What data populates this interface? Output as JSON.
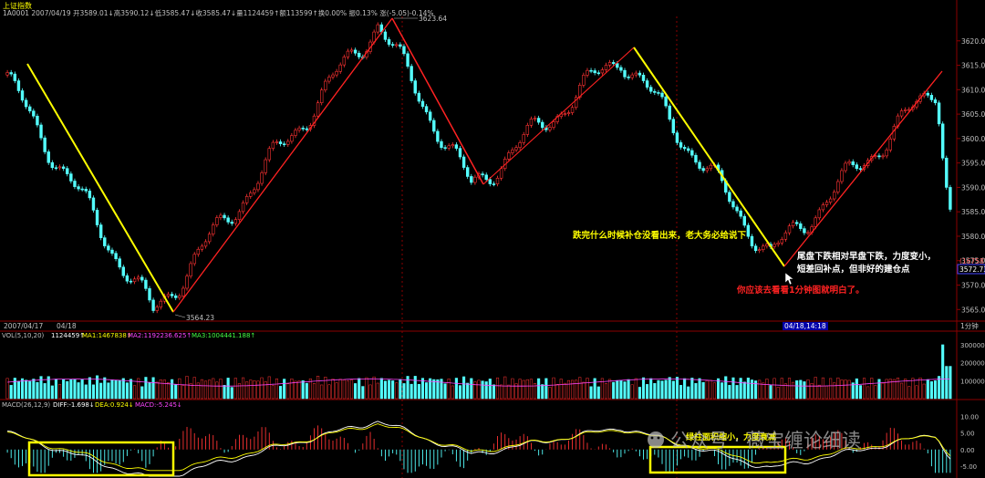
{
  "header": {
    "title": "上证指数",
    "info_line": "1A0001 2007/04/19 开3589.01↓高3590.12↓低3585.47↓收3585.47↓量1124459↑额113599↑换0.00% 振0.13% 涨(-5.05)-0.14%"
  },
  "annotations": {
    "high_label": "3623.64",
    "low_label": "3564.23",
    "note_yellow": "跌完什么时候补仓没看出来，老大务必给说下",
    "note_white_1": "尾盘下跌相对早盘下跌，力度变小，",
    "note_white_2": "短差回补点，但非好的建仓点",
    "note_red": "你应该去看看1分钟图就明白了。",
    "macd_note": "绿柱面积缩小，力度衰减"
  },
  "price_axis": {
    "ticks": [
      "3620.00",
      "3615.00",
      "3610.00",
      "3605.00",
      "3600.00",
      "3595.00",
      "3590.00",
      "3585.00",
      "3580.00",
      "3575.00",
      "3570.00",
      "3565.00"
    ],
    "current_badge": "(16758)",
    "current_price": "3572.73"
  },
  "time_axis": {
    "left_date": "2007/04/17",
    "left_time": "04/18",
    "cursor_label": "04/18,14:18",
    "period": "1分钟"
  },
  "volume_panel": {
    "title": "VOL(5,10,20)",
    "vol": "1124459↑",
    "ma1": "MA1:1467838↑",
    "ma2": "MA2:1192236.625↑",
    "ma3": "MA3:1004441.188↑",
    "ticks": [
      "300000",
      "200000",
      "100000"
    ]
  },
  "macd_panel": {
    "title": "MACD(26,12,9)",
    "diff": "DIFF:-1.698↓",
    "dea": "DEA:0.924↓",
    "macd": "MACD:-5.245↓",
    "ticks": [
      "10.00",
      "5.00",
      "0.00",
      "-5.00"
    ]
  },
  "watermark": {
    "text": "公众号 · 薇宝缠论细读"
  },
  "colors": {
    "up": "#ff3333",
    "down": "#54ffff",
    "trend_down": "#ffff00",
    "trend_up": "#ff2222",
    "ma1": "#ffffff",
    "ma2": "#ffff00",
    "ma3": "#ff44ff",
    "grid": "#8b0000",
    "note_yellow": "#ffff00",
    "note_white": "#ffffff",
    "note_red": "#ff2222"
  },
  "chart_data": [
    {
      "type": "candlestick",
      "title": "上证指数",
      "ylim": [
        3563,
        3625
      ],
      "x_range": [
        "2007/04/17",
        "2007/04/19"
      ],
      "swing_points": [
        {
          "label": "start",
          "price": 3613
        },
        {
          "label": "low",
          "price": 3564.23
        },
        {
          "label": "high",
          "price": 3623.64
        },
        {
          "label": "pullback",
          "price": 3590
        },
        {
          "label": "rebound",
          "price": 3617
        },
        {
          "label": "low2",
          "price": 3576
        },
        {
          "label": "end-high",
          "price": 3611
        }
      ],
      "last_close": 3585.47
    },
    {
      "type": "bar",
      "title": "VOL(5,10,20)",
      "ylim": [
        0,
        330000
      ],
      "last_value": 1124459,
      "peak_value": 300000
    },
    {
      "type": "bar",
      "title": "MACD(26,12,9)",
      "ylim": [
        -8,
        12
      ],
      "series": [
        {
          "name": "DIFF",
          "last": -1.698
        },
        {
          "name": "DEA",
          "last": 0.924
        },
        {
          "name": "MACD",
          "last": -5.245
        }
      ]
    }
  ]
}
